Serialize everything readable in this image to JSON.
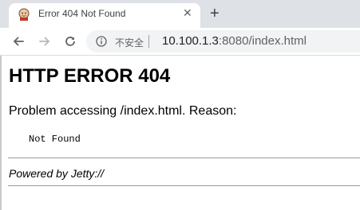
{
  "browser": {
    "tab": {
      "title": "Error 404 Not Found",
      "icon": "jenkins-favicon-icon"
    },
    "address_bar": {
      "security_label": "不安全",
      "url_host": "10.100.1.3",
      "url_rest": ":8080/index.html"
    }
  },
  "page": {
    "heading": "HTTP ERROR 404",
    "reason": "Problem accessing /index.html. Reason:",
    "message": "Not Found",
    "powered_by": "Powered by Jetty://"
  },
  "colors": {
    "tabstrip": "#dee1e6",
    "omnibox": "#f1f3f4",
    "text": "#000000"
  }
}
